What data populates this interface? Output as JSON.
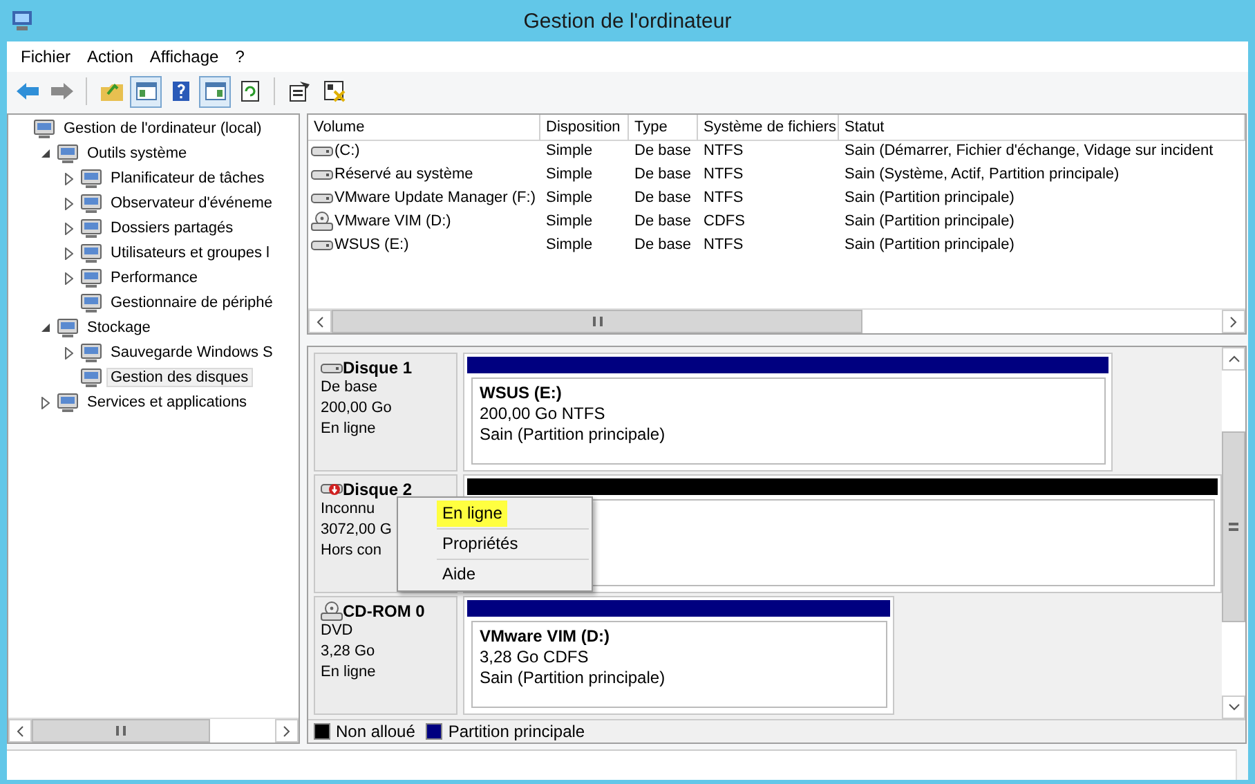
{
  "window": {
    "title": "Gestion de l'ordinateur"
  },
  "menu": [
    "Fichier",
    "Action",
    "Affichage",
    "?"
  ],
  "toolbar": [
    {
      "pressed": false
    },
    {
      "pressed": false
    },
    {
      "pressed": false
    },
    {
      "pressed": true
    },
    {
      "pressed": false
    },
    {
      "pressed": true
    },
    {
      "pressed": false
    },
    {
      "pressed": false
    },
    {
      "pressed": false
    }
  ],
  "tree": [
    {
      "label": "Gestion de l'ordinateur (local)",
      "selected": false,
      "children": [
        {
          "label": "Outils système",
          "expanded": true,
          "selected": false,
          "children": [
            {
              "label": "Planificateur de tâches",
              "expanded": false,
              "selected": false
            },
            {
              "label": "Observateur d'événeme",
              "expanded": false,
              "selected": false
            },
            {
              "label": "Dossiers partagés",
              "expanded": false,
              "selected": false
            },
            {
              "label": "Utilisateurs et groupes l",
              "expanded": false,
              "selected": false
            },
            {
              "label": "Performance",
              "expanded": false,
              "selected": false
            },
            {
              "label": "Gestionnaire de périphé",
              "selected": false
            }
          ]
        },
        {
          "label": "Stockage",
          "expanded": true,
          "selected": false,
          "children": [
            {
              "label": "Sauvegarde Windows S",
              "expanded": false,
              "selected": false
            },
            {
              "label": "Gestion des disques",
              "selected": true
            }
          ]
        },
        {
          "label": "Services et applications",
          "expanded": false,
          "selected": false
        }
      ]
    }
  ],
  "volumes": {
    "columns": [
      "Volume",
      "Disposition",
      "Type",
      "Système de fichiers",
      "Statut"
    ],
    "rows": [
      {
        "kind": "disk",
        "cells": [
          " (C:)",
          "Simple",
          "De base",
          "NTFS",
          "Sain (Démarrer, Fichier d'échange, Vidage sur incident"
        ]
      },
      {
        "kind": "disk",
        "cells": [
          "Réservé au système",
          "Simple",
          "De base",
          "NTFS",
          "Sain (Système, Actif, Partition principale)"
        ]
      },
      {
        "kind": "disk",
        "cells": [
          "VMware Update Manager (F:)",
          "Simple",
          "De base",
          "NTFS",
          "Sain (Partition principale)"
        ]
      },
      {
        "kind": "cd",
        "cells": [
          "VMware VIM (D:)",
          "Simple",
          "De base",
          "CDFS",
          "Sain (Partition principale)"
        ]
      },
      {
        "kind": "disk",
        "cells": [
          "WSUS (E:)",
          "Simple",
          "De base",
          "NTFS",
          "Sain (Partition principale)"
        ]
      }
    ]
  },
  "disks": [
    {
      "kind": "basic",
      "name": "Disque 1",
      "lines": [
        "De base",
        "200,00 Go",
        "En ligne"
      ],
      "partitions": [
        {
          "kind": "primary",
          "color": "#000080",
          "title": "WSUS  (E:)",
          "lines": [
            "200,00 Go NTFS",
            "Sain (Partition principale)"
          ]
        }
      ]
    },
    {
      "kind": "offline",
      "name": "Disque 2",
      "lines": [
        "Inconnu",
        "3072,00 G",
        "Hors con"
      ],
      "partitions": [
        {
          "kind": "unallocated",
          "color": "#000000"
        }
      ]
    },
    {
      "kind": "cdrom",
      "name": "CD-ROM 0",
      "lines": [
        "DVD",
        "3,28 Go",
        "En ligne"
      ],
      "partitions": [
        {
          "kind": "cd",
          "color": "#000080",
          "title": "VMware VIM  (D:)",
          "lines": [
            "3,28 Go CDFS",
            "Sain (Partition principale)"
          ]
        }
      ]
    }
  ],
  "legend": [
    {
      "label": "Non alloué",
      "color": "#000000"
    },
    {
      "label": "Partition principale",
      "color": "#000080"
    }
  ],
  "context_menu": [
    {
      "label": "En ligne",
      "selected": true
    },
    {
      "label": "Propriétés",
      "selected": false
    },
    {
      "label": "Aide",
      "selected": false
    }
  ]
}
